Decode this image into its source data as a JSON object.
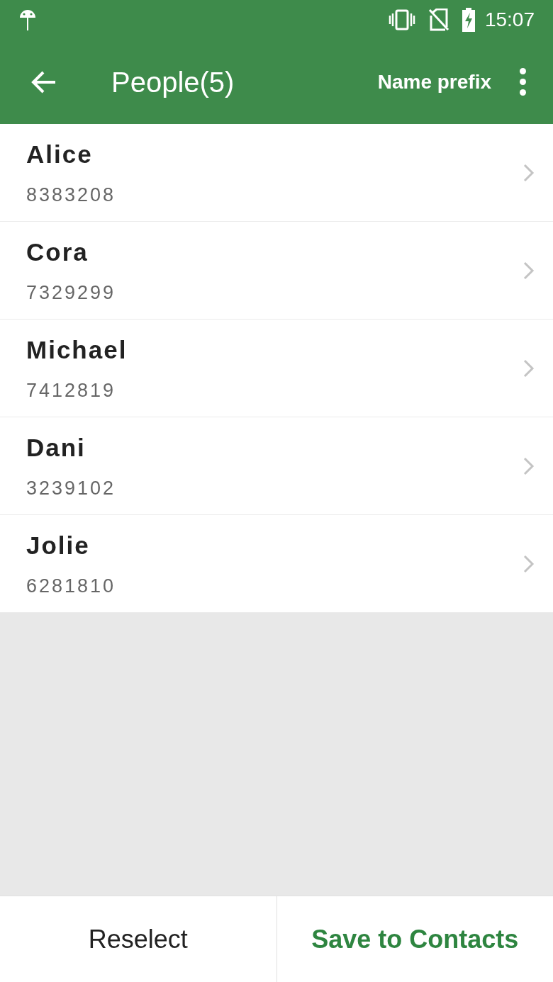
{
  "status_bar": {
    "time": "15:07"
  },
  "toolbar": {
    "title": "People(5)",
    "action": "Name prefix"
  },
  "contacts": [
    {
      "name": "Alice",
      "number": "8383208"
    },
    {
      "name": "Cora",
      "number": "7329299"
    },
    {
      "name": "Michael",
      "number": "7412819"
    },
    {
      "name": "Dani",
      "number": "3239102"
    },
    {
      "name": "Jolie",
      "number": "6281810"
    }
  ],
  "buttons": [
    {
      "label": "Reselect",
      "kind": "plain"
    },
    {
      "label": "Save to Contacts",
      "kind": "primary"
    }
  ]
}
